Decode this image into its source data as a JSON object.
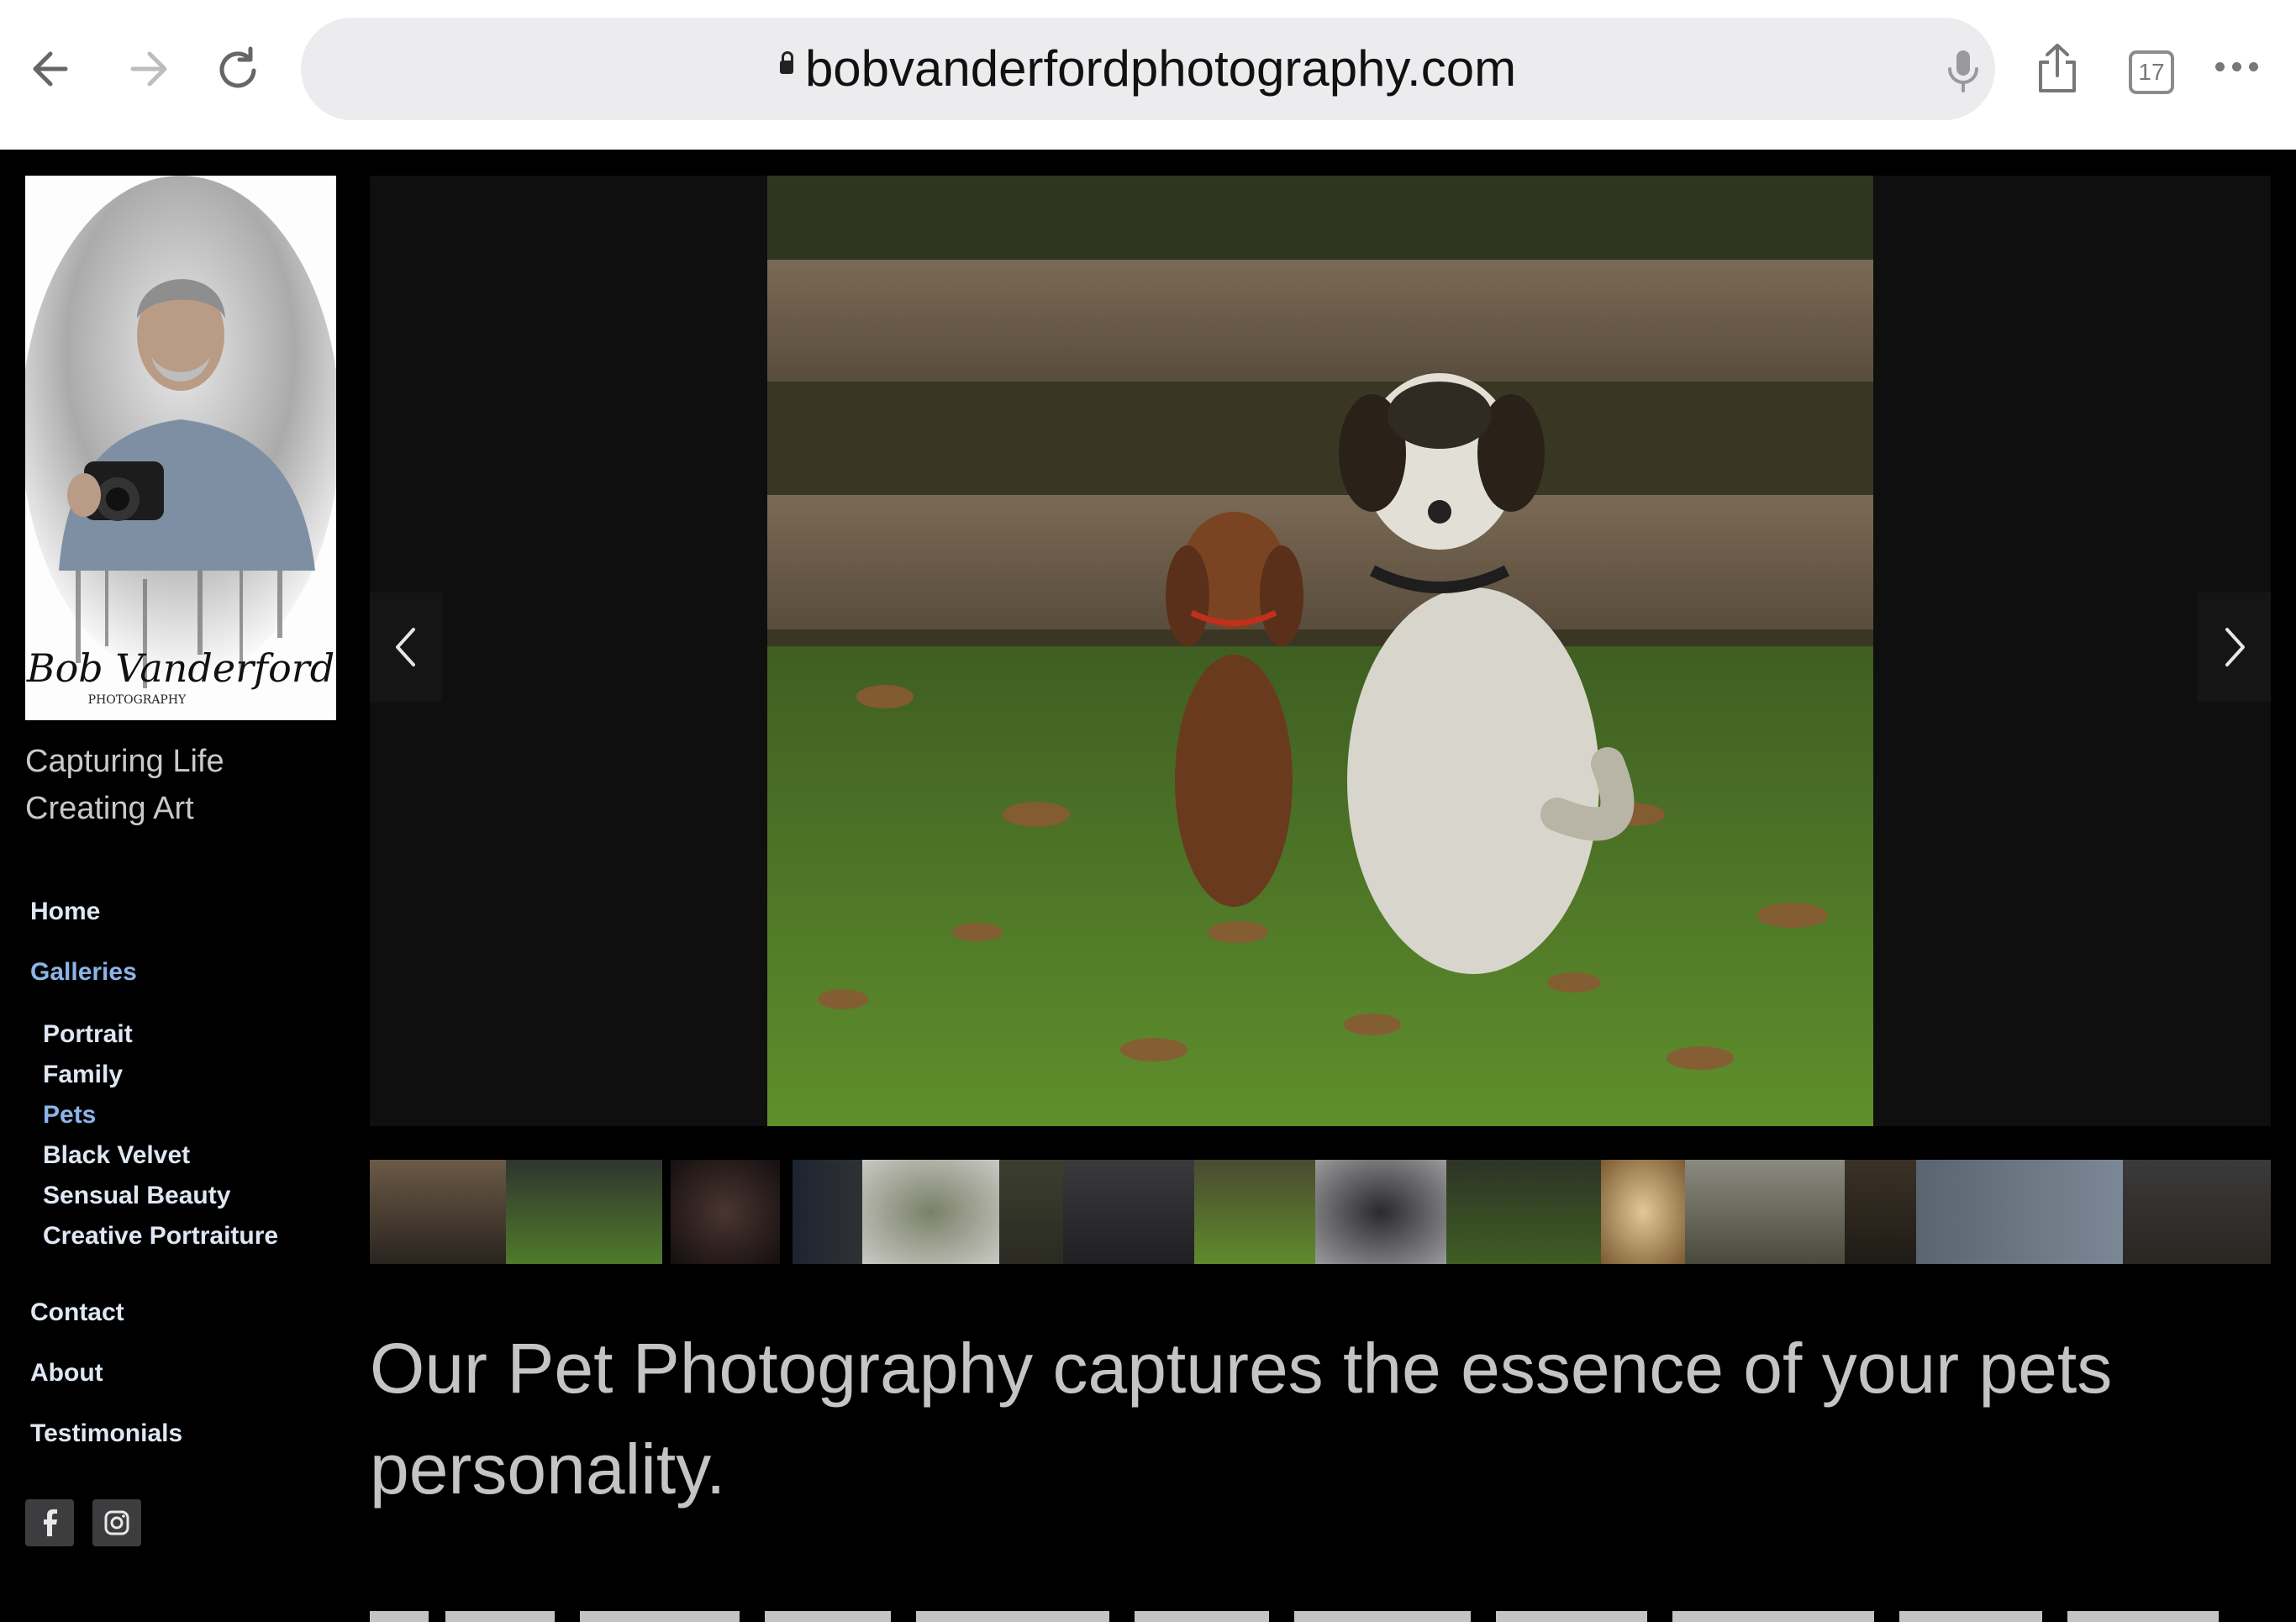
{
  "browser": {
    "url": "bobvanderfordphotography.com",
    "tab_count": "17",
    "icons": [
      "back-arrow-icon",
      "forward-arrow-icon",
      "reload-icon",
      "lock-icon",
      "microphone-icon",
      "share-icon",
      "tabs-icon",
      "more-icon"
    ]
  },
  "sidebar": {
    "logo_signature": "Bob Vanderford",
    "logo_caption": "PHOTOGRAPHY",
    "tagline_line1": "Capturing Life",
    "tagline_line2": "Creating Art",
    "nav": {
      "home": "Home",
      "galleries": "Galleries",
      "portrait": "Portrait",
      "family": "Family",
      "pets": "Pets",
      "black_velvet": "Black Velvet",
      "sensual_beauty": "Sensual Beauty",
      "creative_portraiture": "Creative Portraiture",
      "contact": "Contact",
      "about": "About",
      "testimonials": "Testimonials"
    },
    "active_item": "Pets",
    "social_icons": [
      "facebook-icon",
      "instagram-icon"
    ]
  },
  "gallery": {
    "current_slide": "dachshund and beagle sitting by a wooden fence",
    "thumbnail_count": 15
  },
  "content": {
    "headline": "Our Pet Photography captures the essence of your pets personality."
  },
  "colors": {
    "background": "#000000",
    "accent_link": "#8cb4e6",
    "nav_text": "#dfe7f3",
    "stage": "#0f0f10"
  }
}
